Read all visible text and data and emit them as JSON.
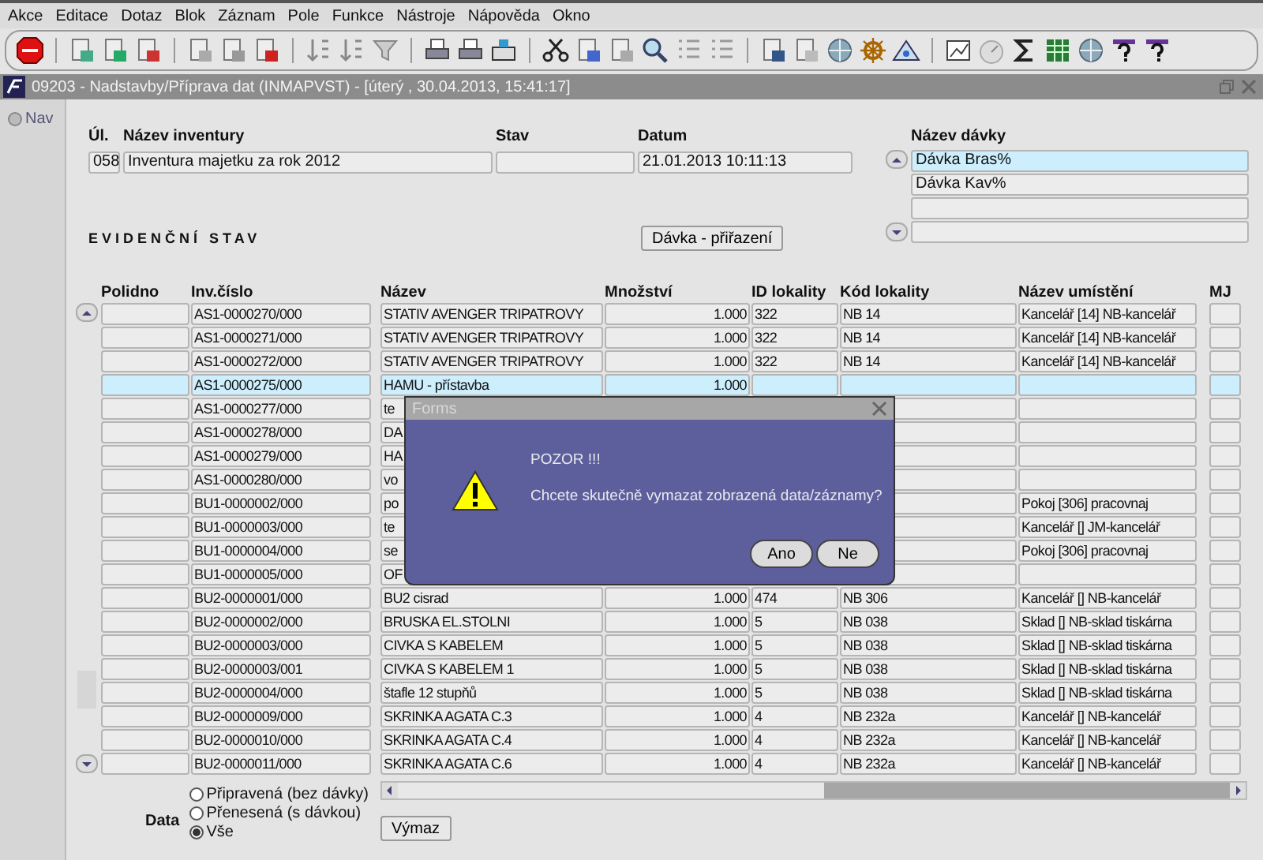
{
  "menu": [
    "Akce",
    "Editace",
    "Dotaz",
    "Blok",
    "Záznam",
    "Pole",
    "Funkce",
    "Nástroje",
    "Nápověda",
    "Okno"
  ],
  "window": {
    "title": "09203 - Nadstavby/Příprava dat (INMAPVST) - [úterý , 30.04.2013, 15:41:17]"
  },
  "nav": {
    "label": "Nav"
  },
  "inventory": {
    "labels": {
      "number": "Úl.",
      "name": "Název inventury",
      "state": "Stav",
      "date": "Datum"
    },
    "number": "058",
    "name": "Inventura majetku za rok 2012",
    "date": "21.01.2013 10:11:13"
  },
  "batches": {
    "label": "Název dávky",
    "items": [
      {
        "name": "Dávka Bras%",
        "selected": true
      },
      {
        "name": "Dávka Kav%",
        "selected": false
      }
    ]
  },
  "section_title": "EVIDENČNÍ STAV",
  "assign_button": "Dávka - přiřazení",
  "table": {
    "columns": [
      "Polidno",
      "Inv.číslo",
      "Název",
      "Množství",
      "ID lokality",
      "Kód lokality",
      "Název umístění",
      "MJ"
    ],
    "rows": [
      {
        "inv": "AS1-0000270/000",
        "name": "STATIV AVENGER TRIPATROVY",
        "qty": "1.000",
        "loc_id": "322",
        "loc_code": "NB 14",
        "place": "Kancelář [14] NB-kancelář",
        "selected": false
      },
      {
        "inv": "AS1-0000271/000",
        "name": "STATIV AVENGER TRIPATROVY",
        "qty": "1.000",
        "loc_id": "322",
        "loc_code": "NB 14",
        "place": "Kancelář [14] NB-kancelář",
        "selected": false
      },
      {
        "inv": "AS1-0000272/000",
        "name": "STATIV AVENGER TRIPATROVY",
        "qty": "1.000",
        "loc_id": "322",
        "loc_code": "NB 14",
        "place": "Kancelář [14] NB-kancelář",
        "selected": false
      },
      {
        "inv": "AS1-0000275/000",
        "name": "HAMU - přístavba",
        "qty": "1.000",
        "selected": true
      },
      {
        "inv": "AS1-0000277/000",
        "name": "te",
        "selected": false
      },
      {
        "inv": "AS1-0000278/000",
        "name": "DA",
        "selected": false
      },
      {
        "inv": "AS1-0000279/000",
        "name": "HA",
        "selected": false
      },
      {
        "inv": "AS1-0000280/000",
        "name": "vo",
        "selected": false
      },
      {
        "inv": "BU1-0000002/000",
        "name": "po",
        "place": "Pokoj [306] pracovnaj",
        "selected": false
      },
      {
        "inv": "BU1-0000003/000",
        "name": "te",
        "place": "Kancelář [] JM-kancelář",
        "selected": false
      },
      {
        "inv": "BU1-0000004/000",
        "name": "se",
        "place": "Pokoj [306] pracovnaj",
        "selected": false
      },
      {
        "inv": "BU1-0000005/000",
        "name": "OF",
        "selected": false
      },
      {
        "inv": "BU2-0000001/000",
        "name": "BU2 cisrad",
        "qty": "1.000",
        "loc_id": "474",
        "loc_code": "NB 306",
        "place": "Kancelář [] NB-kancelář",
        "selected": false
      },
      {
        "inv": "BU2-0000002/000",
        "name": "BRUSKA EL.STOLNI",
        "qty": "1.000",
        "loc_id": "5",
        "loc_code": "NB 038",
        "place": "Sklad [] NB-sklad tiskárna",
        "selected": false
      },
      {
        "inv": "BU2-0000003/000",
        "name": "CIVKA S KABELEM",
        "qty": "1.000",
        "loc_id": "5",
        "loc_code": "NB 038",
        "place": "Sklad [] NB-sklad tiskárna",
        "selected": false
      },
      {
        "inv": "BU2-0000003/001",
        "name": "CIVKA S KABELEM 1",
        "qty": "1.000",
        "loc_id": "5",
        "loc_code": "NB 038",
        "place": "Sklad [] NB-sklad tiskárna",
        "selected": false
      },
      {
        "inv": "BU2-0000004/000",
        "name": "štafle 12 stupňů",
        "qty": "1.000",
        "loc_id": "5",
        "loc_code": "NB 038",
        "place": "Sklad [] NB-sklad tiskárna",
        "selected": false
      },
      {
        "inv": "BU2-0000009/000",
        "name": "SKRINKA AGATA C.3",
        "qty": "1.000",
        "loc_id": "4",
        "loc_code": "NB 232a",
        "place": "Kancelář [] NB-kancelář",
        "selected": false
      },
      {
        "inv": "BU2-0000010/000",
        "name": "SKRINKA AGATA C.4",
        "qty": "1.000",
        "loc_id": "4",
        "loc_code": "NB 232a",
        "place": "Kancelář [] NB-kancelář",
        "selected": false
      },
      {
        "inv": "BU2-0000011/000",
        "name": "SKRINKA AGATA C.6",
        "qty": "1.000",
        "loc_id": "4",
        "loc_code": "NB 232a",
        "place": "Kancelář [] NB-kancelář",
        "selected": false
      }
    ]
  },
  "data_filter": {
    "label": "Data",
    "options": [
      {
        "label": "Připravená (bez dávky)",
        "selected": false
      },
      {
        "label": "Přenesená (s dávkou)",
        "selected": false
      },
      {
        "label": "Vše",
        "selected": true
      }
    ]
  },
  "delete_button": "Výmaz",
  "dialog": {
    "title": "Forms",
    "heading": "POZOR !!!",
    "message": "Chcete skutečně vymazat zobrazená data/záznamy?",
    "buttons": [
      "Ano",
      "Ne"
    ]
  }
}
